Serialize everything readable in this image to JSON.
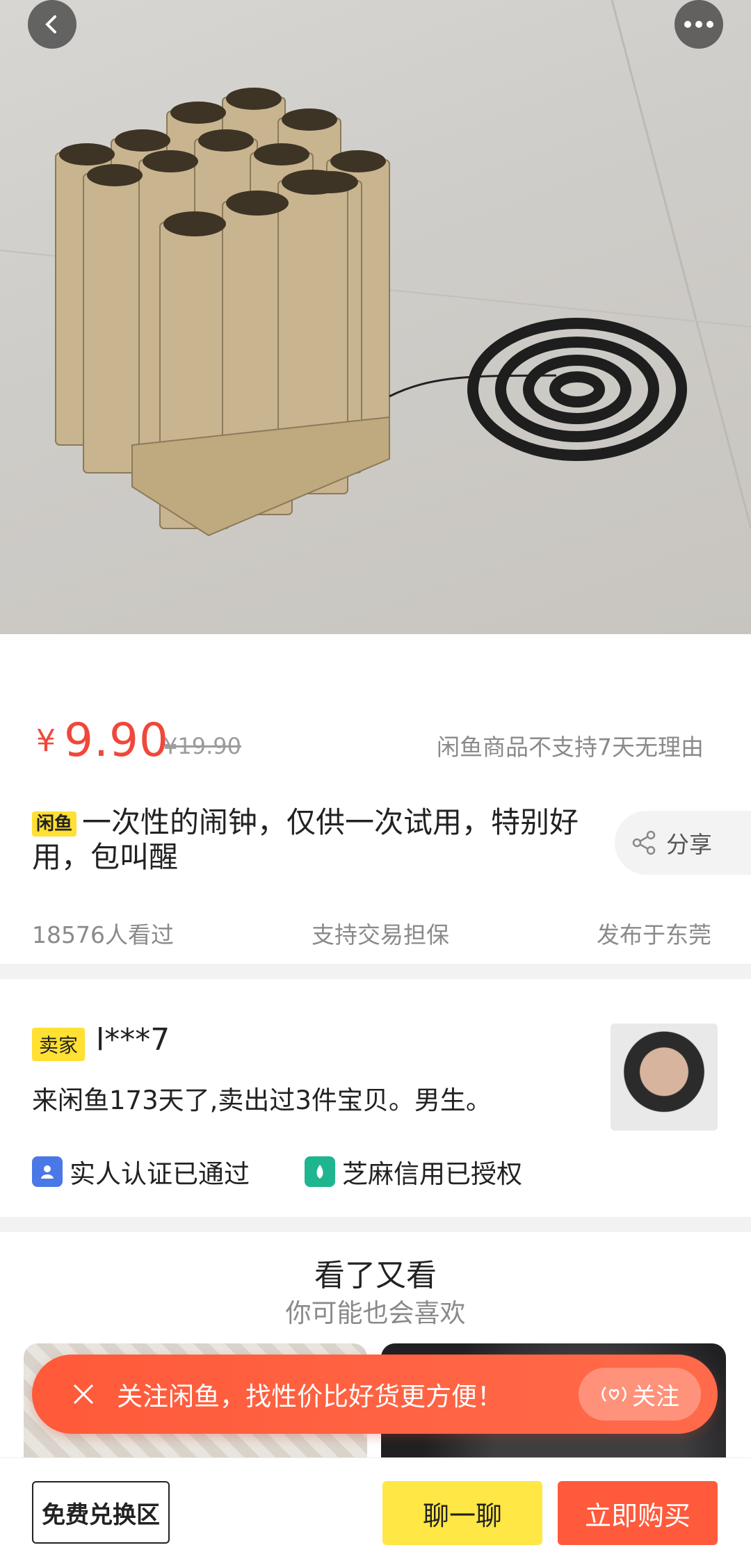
{
  "product": {
    "price_symbol": "¥",
    "price": "9.90",
    "original_price": "¥19.90",
    "return_policy": "闲鱼商品不支持7天无理由",
    "tag": "闲鱼",
    "title": "一次性的闹钟，仅供一次试用，特别好用，包叫醒",
    "share_label": "分享",
    "views": "18576人看过",
    "guarantee": "支持交易担保",
    "location": "发布于东莞"
  },
  "seller": {
    "tag": "卖家",
    "name": "l***7",
    "description": "来闲鱼173天了,卖出过3件宝贝。男生。",
    "verify_real": "实人认证已通过",
    "verify_zhima": "芝麻信用已授权"
  },
  "recommend": {
    "title": "看了又看",
    "subtitle": "你可能也会喜欢"
  },
  "follow_banner": {
    "text": "关注闲鱼，找性价比好货更方便！",
    "button": "关注"
  },
  "bottom_bar": {
    "exchange": "免费兑换区",
    "chat": "聊一聊",
    "buy": "立即购买"
  },
  "colors": {
    "price": "#f0473a",
    "tag_yellow": "#ffe033",
    "buy": "#ff5a3c",
    "chat": "#ffe746"
  }
}
